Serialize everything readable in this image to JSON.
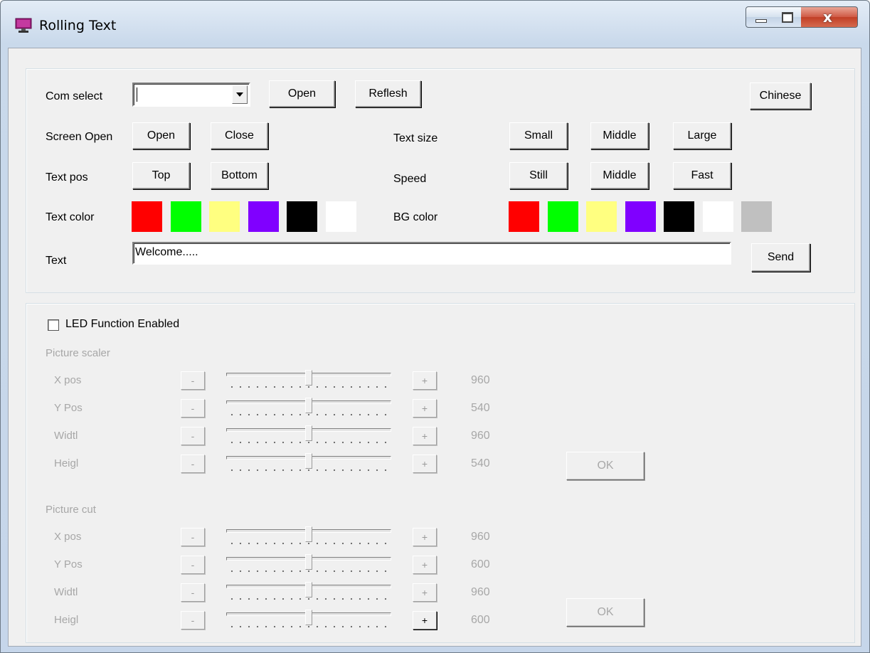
{
  "window": {
    "title": "Rolling Text"
  },
  "top": {
    "com_select_label": "Com select",
    "com_value": "",
    "open_label": "Open",
    "refresh_label": "Reflesh",
    "chinese_label": "Chinese",
    "screen_open_label": "Screen Open",
    "screen_open_btn": "Open",
    "screen_close_btn": "Close",
    "text_size_label": "Text size",
    "size_small": "Small",
    "size_middle": "Middle",
    "size_large": "Large",
    "text_pos_label": "Text pos",
    "pos_top": "Top",
    "pos_bottom": "Bottom",
    "speed_label": "Speed",
    "speed_still": "Still",
    "speed_middle": "Middle",
    "speed_fast": "Fast",
    "text_color_label": "Text color",
    "text_colors": [
      "#ff0000",
      "#00ff00",
      "#ffff80",
      "#8000ff",
      "#000000",
      "#ffffff"
    ],
    "bg_color_label": "BG color",
    "bg_colors": [
      "#ff0000",
      "#00ff00",
      "#ffff80",
      "#8000ff",
      "#000000",
      "#ffffff",
      "#c0c0c0"
    ],
    "text_label": "Text",
    "text_value": "Welcome.....",
    "send_label": "Send"
  },
  "led": {
    "enabled_label": "LED Function Enabled",
    "enabled": false,
    "scaler_title": "Picture scaler",
    "cut_title": "Picture cut",
    "minus": "-",
    "plus": "+",
    "ok_label": "OK",
    "scaler": [
      {
        "label": "X pos",
        "value": "960",
        "level": 0.5
      },
      {
        "label": "Y Pos",
        "value": "540",
        "level": 0.5
      },
      {
        "label": "Widtl",
        "value": "960",
        "level": 0.5
      },
      {
        "label": "Heigl",
        "value": "540",
        "level": 0.5
      }
    ],
    "cut": [
      {
        "label": "X pos",
        "value": "960",
        "level": 0.5
      },
      {
        "label": "Y Pos",
        "value": "600",
        "level": 0.5
      },
      {
        "label": "Widtl",
        "value": "960",
        "level": 0.5
      },
      {
        "label": "Heigl",
        "value": "600",
        "level": 0.5
      }
    ]
  }
}
